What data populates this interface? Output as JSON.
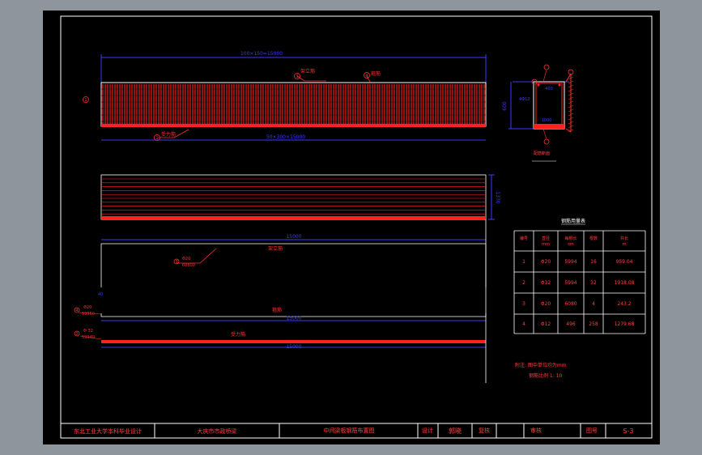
{
  "colors": {
    "background": "#000000",
    "frame": "#ffffff",
    "rebar": "#ff2020",
    "dimension": "#3a3aff",
    "leader": "#ff3030",
    "annotation": "#ff4040",
    "title_text": "#ff4040"
  },
  "elevation": {
    "top_dimension": "100×150=15000",
    "bottom_dimension": "50×300×15000",
    "label_stirrup": "架立筋",
    "label_hook": "箍筋",
    "label_main": "受力筋",
    "marker_1": "1",
    "marker_3": "3",
    "marker_4": "4",
    "marker_2": "2"
  },
  "section": {
    "height_dim": "600",
    "width_dim": "400",
    "top_note": "4Φ12",
    "bottom_note": "1000",
    "caption": "配筋断面"
  },
  "plan": {
    "side_dimension": "1370"
  },
  "bars": {
    "dim_bar3": "15000",
    "bar3_marker": "3",
    "bar3_spec": "Φ20",
    "bar3_len": "60800",
    "bar3_label": "架立筋",
    "left_small": "40",
    "dim_bar4": "15000",
    "bar4_marker": "4",
    "bar4_spec": "Φ20",
    "bar4_len": "59960",
    "bar4_label": "箍筋",
    "bar2_marker": "2",
    "bar2_spec": "Φ 32",
    "bar2_len": "59940",
    "bar2_label": "受力筋",
    "dim_bar2": "15000"
  },
  "table": {
    "title": "钢筋用量表",
    "headers": [
      "编号",
      "直径\nmm",
      "每根长\ncm",
      "根数",
      "共长\nm"
    ],
    "rows": [
      [
        "1",
        "Φ20",
        "5994",
        "16",
        "959.04"
      ],
      [
        "2",
        "Φ32",
        "5994",
        "32",
        "1918.08"
      ],
      [
        "3",
        "Φ20",
        "6080",
        "4",
        "243.2"
      ],
      [
        "4",
        "Φ12",
        "496",
        "258",
        "1279.68"
      ]
    ]
  },
  "notes": {
    "line1": "附注: 图中单位均为mm",
    "line2": "钢筋比例 1: 10"
  },
  "title_block": {
    "school": "东北工业大学本科毕业设计",
    "project": "大庆市市政桥梁",
    "drawing_name": "中间梁板钢筋布置图",
    "design_label": "设计",
    "design_name": "郭晓",
    "check_label": "复核",
    "review_label": "审核",
    "number_label": "图号",
    "number_value": "S-3"
  }
}
